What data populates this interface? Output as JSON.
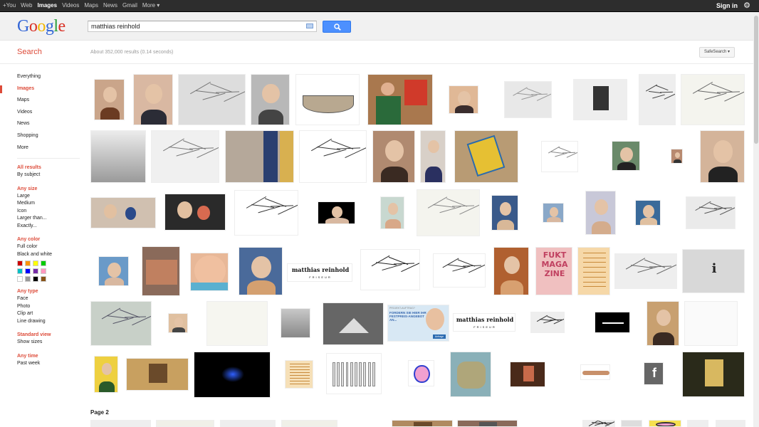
{
  "topbar": {
    "links": [
      "+You",
      "Web",
      "Images",
      "Videos",
      "Maps",
      "News",
      "Gmail",
      "More ▾"
    ],
    "active": "Images",
    "signin": "Sign in"
  },
  "header": {
    "logo": [
      "G",
      "o",
      "o",
      "g",
      "l",
      "e"
    ],
    "query": "matthias reinhold"
  },
  "subbar": {
    "search_label": "Search",
    "stats": "About 352,000 results (0.14 seconds)",
    "safesearch": "SafeSearch ▾"
  },
  "sidebar": {
    "nav": [
      "Everything",
      "Images",
      "Maps",
      "Videos",
      "News",
      "Shopping",
      "More"
    ],
    "active": "Images",
    "groups": [
      {
        "title": "All results",
        "options": [
          "By subject"
        ]
      },
      {
        "title": "Any size",
        "options": [
          "Large",
          "Medium",
          "Icon",
          "Larger than...",
          "Exactly..."
        ]
      },
      {
        "title": "Any color",
        "options": [
          "Full color",
          "Black and white"
        ]
      },
      {
        "title": "Any type",
        "options": [
          "Face",
          "Photo",
          "Clip art",
          "Line drawing"
        ]
      },
      {
        "title": "Standard view",
        "options": [
          "Show sizes"
        ]
      },
      {
        "title": "Any time",
        "options": [
          "Past week"
        ]
      }
    ],
    "swatch_colors": [
      "#cc0000",
      "#fb940b",
      "#ffff00",
      "#00cc00",
      "#03c0c6",
      "#0000ff",
      "#762ca7",
      "#ff98bf",
      "#ffffff",
      "#999999",
      "#000000",
      "#885418"
    ]
  },
  "results": {
    "page2_label": "Page 2",
    "texts": {
      "logo_text": "matthias reinhold",
      "logo_sub": "FRISEUR",
      "fukt": "FUKT MAGA ZINE",
      "ad_head": "PROJEKT-AUFTRAG?",
      "ad_body": "FORDERN SIE HIER IHR FESTPREIS-ANGEBOT AN...",
      "ad_btn": "Anfrage",
      "fb": "f",
      "i": "i"
    }
  }
}
